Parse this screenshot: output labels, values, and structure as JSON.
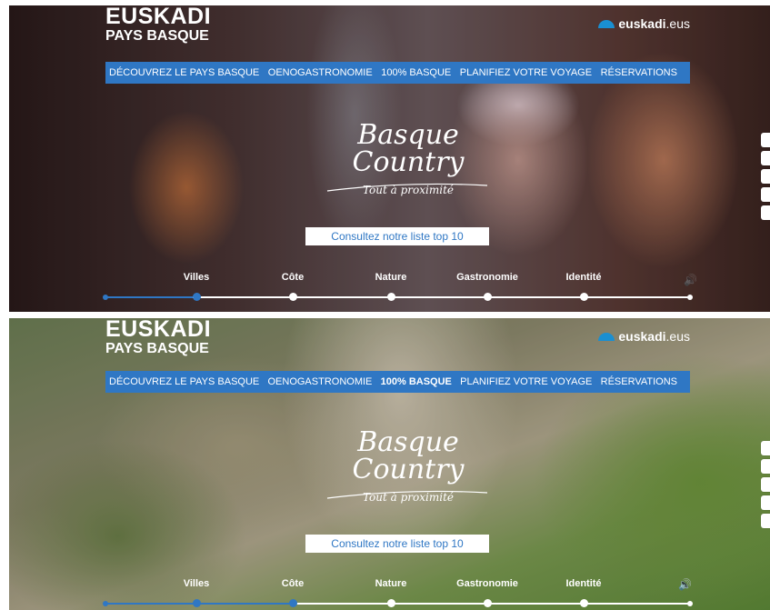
{
  "brand": {
    "logo_main": "EUSKADI",
    "logo_sub": "PAYS BASQUE",
    "site_bold": "euskadi",
    "site_rest": ".eus"
  },
  "nav": {
    "items": [
      "DÉCOUVREZ LE PAYS BASQUE",
      "OENOGASTRONOMIE",
      "100% BASQUE",
      "PLANIFIEZ VOTRE VOYAGE",
      "RÉSERVATIONS"
    ]
  },
  "hero": {
    "line1": "Basque",
    "line2": "Country",
    "line3": "Tout à proximité",
    "cta": "Consultez notre liste top 10"
  },
  "categories": [
    "Villes",
    "Côte",
    "Nature",
    "Gastronomie",
    "Identité"
  ],
  "screens": [
    {
      "active_nav": -1,
      "progress_fraction": 0.15
    },
    {
      "active_nav": 2,
      "progress_fraction": 0.32
    }
  ],
  "speaker_icon": "volume-icon",
  "colors": {
    "nav_blue": "#2f77c4",
    "brand_icon": "#1a8fd1",
    "cta_text": "#2f77c4"
  }
}
